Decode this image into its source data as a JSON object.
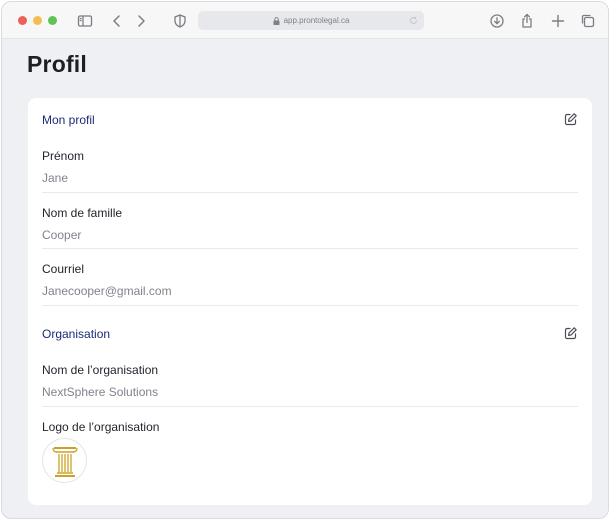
{
  "browser": {
    "url": "app.prontolegal.ca"
  },
  "page": {
    "title": "Profil"
  },
  "profile": {
    "section_title": "Mon profil",
    "fields": [
      {
        "label": "Prénom",
        "value": "Jane"
      },
      {
        "label": "Nom de famille",
        "value": "Cooper"
      },
      {
        "label": "Courriel",
        "value": "Janecooper@gmail.com"
      }
    ]
  },
  "organisation": {
    "section_title": "Organisation",
    "name_label": "Nom de l’organisation",
    "name_value": "NextSphere Solutions",
    "logo_label": "Logo de l’organisation",
    "logo_icon": "column-pillar-icon"
  },
  "colors": {
    "accent": "#1b2a78",
    "logo_gold": "#c9a227"
  }
}
